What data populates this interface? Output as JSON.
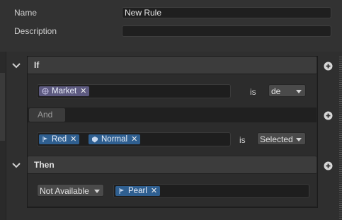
{
  "fields": {
    "name_label": "Name",
    "name_value": "New Rule",
    "description_label": "Description",
    "description_value": ""
  },
  "if_section": {
    "header": "If",
    "condition1": {
      "tags": [
        {
          "label": "Market",
          "icon": "globe-icon",
          "color": "#5d5a80"
        }
      ],
      "operator": "is",
      "value": "de"
    },
    "and_label": "And",
    "condition2": {
      "tags": [
        {
          "label": "Red",
          "icon": "flag-icon",
          "color": "#2f5f90"
        },
        {
          "label": "Normal",
          "icon": "shield-icon",
          "color": "#2f5f90"
        }
      ],
      "operator": "is",
      "value": "Selected"
    }
  },
  "then_section": {
    "header": "Then",
    "action": "Not Available",
    "tags": [
      {
        "label": "Pearl",
        "icon": "flag-icon",
        "color": "#2f5f90"
      }
    ]
  },
  "icons": {
    "remove_glyph": "✕"
  }
}
